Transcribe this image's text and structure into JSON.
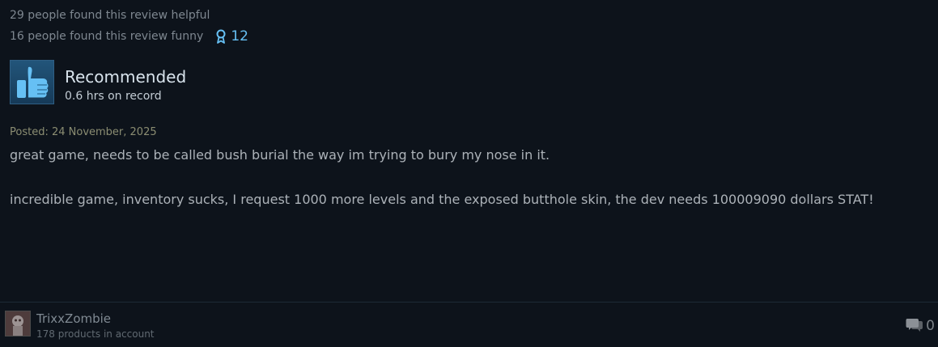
{
  "review": {
    "helpful_text": "29 people found this review helpful",
    "funny_text": "16 people found this review funny",
    "award_count": "12",
    "verdict": "Recommended",
    "hours": "0.6 hrs on record",
    "posted": "Posted: 24 November, 2025",
    "body_lines": [
      "great game, needs to be called bush burial the way im trying to bury my nose in it.",
      "incredible game, inventory sucks, I request 1000 more levels and the exposed butthole skin, the dev needs 100009090 dollars STAT!"
    ]
  },
  "author": {
    "username": "TrixxZombie",
    "products": "178 products in account"
  },
  "comments": {
    "count": "0"
  },
  "icons": {
    "award": "award-ribbon-icon",
    "thumb": "thumbs-up-icon",
    "comment": "comment-bubbles-icon"
  },
  "colors": {
    "background": "#0d131b",
    "accent": "#66c0f4",
    "muted_text": "#7e8790",
    "body_text": "#acb2b8",
    "posted_text": "#8b8d72"
  }
}
